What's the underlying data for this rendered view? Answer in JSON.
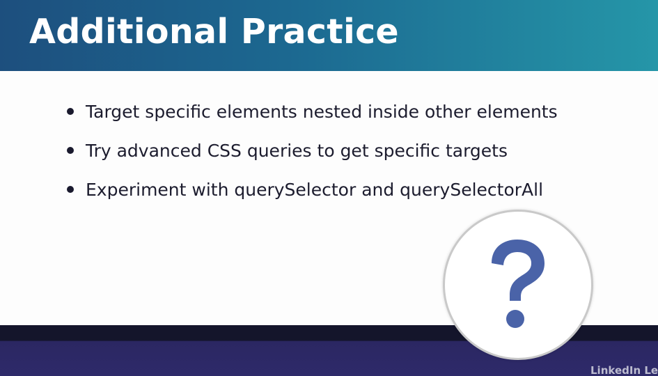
{
  "slide": {
    "title": "Additional Practice",
    "bullets": [
      "Target specific elements nested inside other elements",
      "Try advanced CSS queries to get specific targets",
      "Experiment with querySelector and querySelectorAll"
    ]
  },
  "graphic": {
    "icon": "question-mark-icon",
    "icon_color": "#4a63a8"
  },
  "watermark": {
    "logo_text": "LinkedIn Learning"
  },
  "colors": {
    "title_bar_start": "#1d4f7e",
    "title_bar_end": "#2596a8",
    "footer_band": "#2e2a6a"
  }
}
